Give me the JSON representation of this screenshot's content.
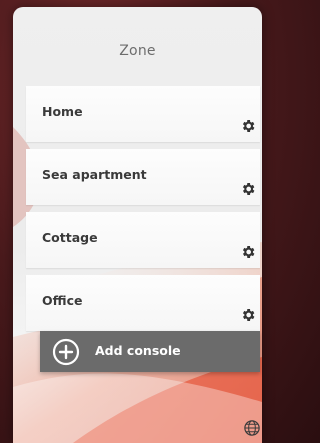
{
  "header": {
    "title": "Zone"
  },
  "zones": [
    {
      "label": "Home",
      "settings_icon": "gear-icon"
    },
    {
      "label": "Sea apartment",
      "settings_icon": "gear-icon"
    },
    {
      "label": "Cottage",
      "settings_icon": "gear-icon"
    },
    {
      "label": "Office",
      "settings_icon": "gear-icon"
    }
  ],
  "add_console": {
    "label": "Add console",
    "icon": "plus-circle-icon"
  },
  "footer": {
    "language_icon": "globe-icon"
  },
  "colors": {
    "background": "#4a1a1c",
    "panel": "#efefef",
    "accent_swoosh": "#d9472b",
    "button": "#6b6b6b",
    "text": "#3a3a3a"
  }
}
